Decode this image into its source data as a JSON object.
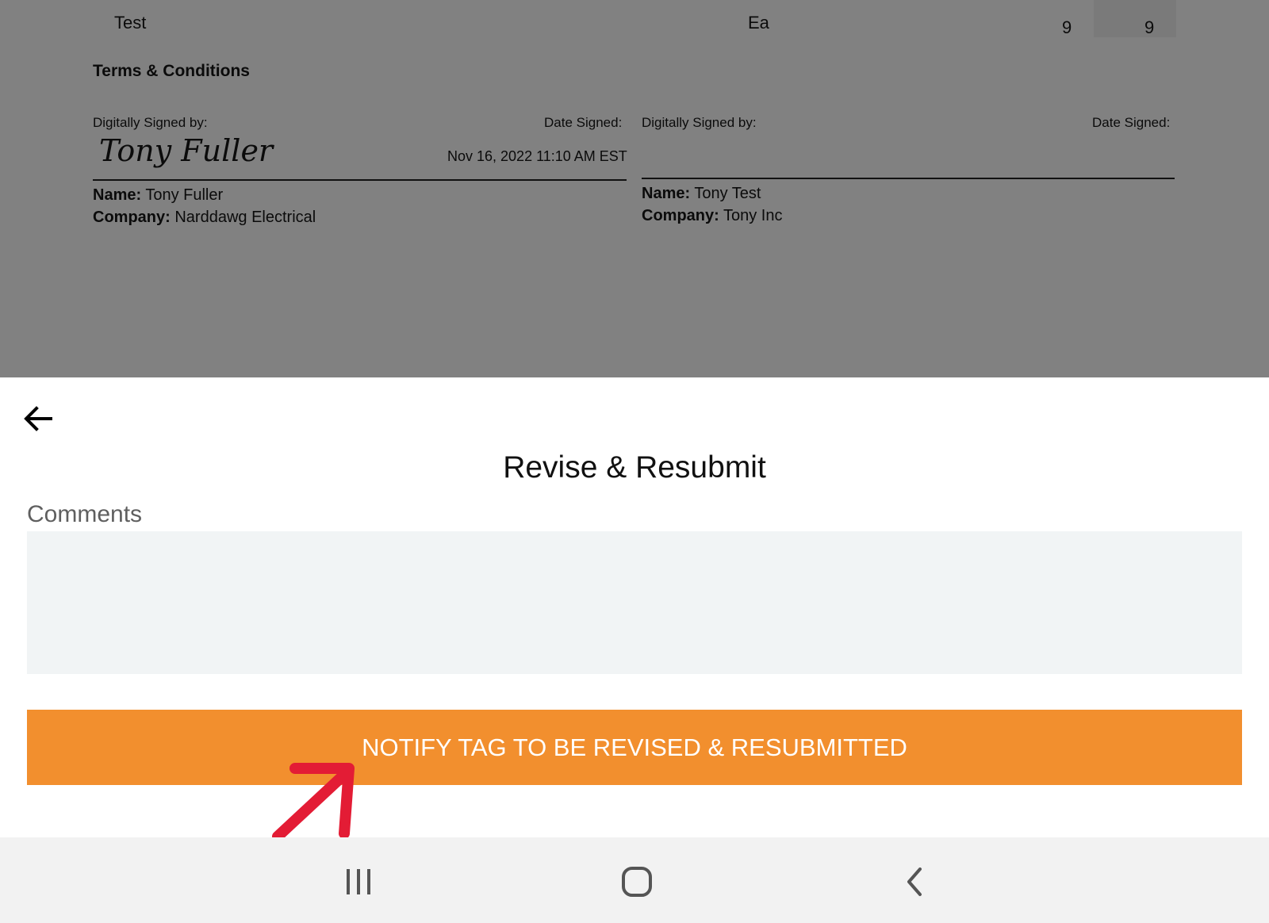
{
  "document": {
    "line_item": {
      "description": "Test",
      "unit": "Ea",
      "quantity": "9",
      "total": "9"
    },
    "terms_heading": "Terms & Conditions",
    "signatures": [
      {
        "signed_by_label": "Digitally Signed by:",
        "date_label": "Date Signed:",
        "signature": "Tony Fuller",
        "date": "Nov 16, 2022 11:10 AM EST",
        "name_label": "Name:",
        "name": "Tony Fuller",
        "company_label": "Company:",
        "company": "Narddawg Electrical"
      },
      {
        "signed_by_label": "Digitally Signed by:",
        "date_label": "Date Signed:",
        "signature": "",
        "date": "",
        "name_label": "Name:",
        "name": "Tony Test",
        "company_label": "Company:",
        "company": "Tony Inc"
      }
    ]
  },
  "sheet": {
    "title": "Revise & Resubmit",
    "comments_label": "Comments",
    "comments_value": "",
    "notify_button": "NOTIFY TAG TO BE REVISED & RESUBMITTED"
  },
  "icons": {
    "back": "arrow-left-icon",
    "recents": "recents-icon",
    "home": "home-icon",
    "nav_back": "chevron-left-icon",
    "annotation": "red-arrow-annotation"
  },
  "colors": {
    "overlay": "#818181",
    "accent": "#f28f2e",
    "annotation": "#e31c35",
    "input_bg": "#f1f4f5"
  }
}
